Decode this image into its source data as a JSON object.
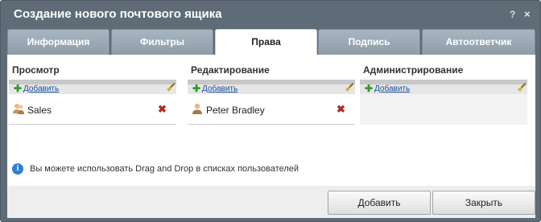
{
  "window": {
    "title": "Создание нового почтового ящика",
    "help_glyph": "?",
    "close_glyph": "×"
  },
  "tabs": [
    {
      "label": "Информация",
      "active": false
    },
    {
      "label": "Фильтры",
      "active": false
    },
    {
      "label": "Права",
      "active": true
    },
    {
      "label": "Подпись",
      "active": false
    },
    {
      "label": "Автоответчик",
      "active": false
    }
  ],
  "columns": [
    {
      "title": "Просмотр",
      "add_label": "Добавить",
      "entries": [
        {
          "name": "Sales",
          "icon": "group-icon"
        }
      ]
    },
    {
      "title": "Редактирование",
      "add_label": "Добавить",
      "entries": [
        {
          "name": "Peter Bradley",
          "icon": "user-icon"
        }
      ]
    },
    {
      "title": "Администрирование",
      "add_label": "Добавить",
      "entries": []
    }
  ],
  "info": {
    "text": "Вы можете использовать Drag and Drop в списках пользователей",
    "icon": "info-icon"
  },
  "buttons": {
    "add_label": "Добавить",
    "close_label": "Закрыть"
  },
  "colors": {
    "titlebar": "#5f6c78",
    "tab_inactive": "#99a7b4",
    "add_link": "#1a4f9c",
    "delete": "#b02a2a",
    "add_icon": "#2e9e2e"
  }
}
